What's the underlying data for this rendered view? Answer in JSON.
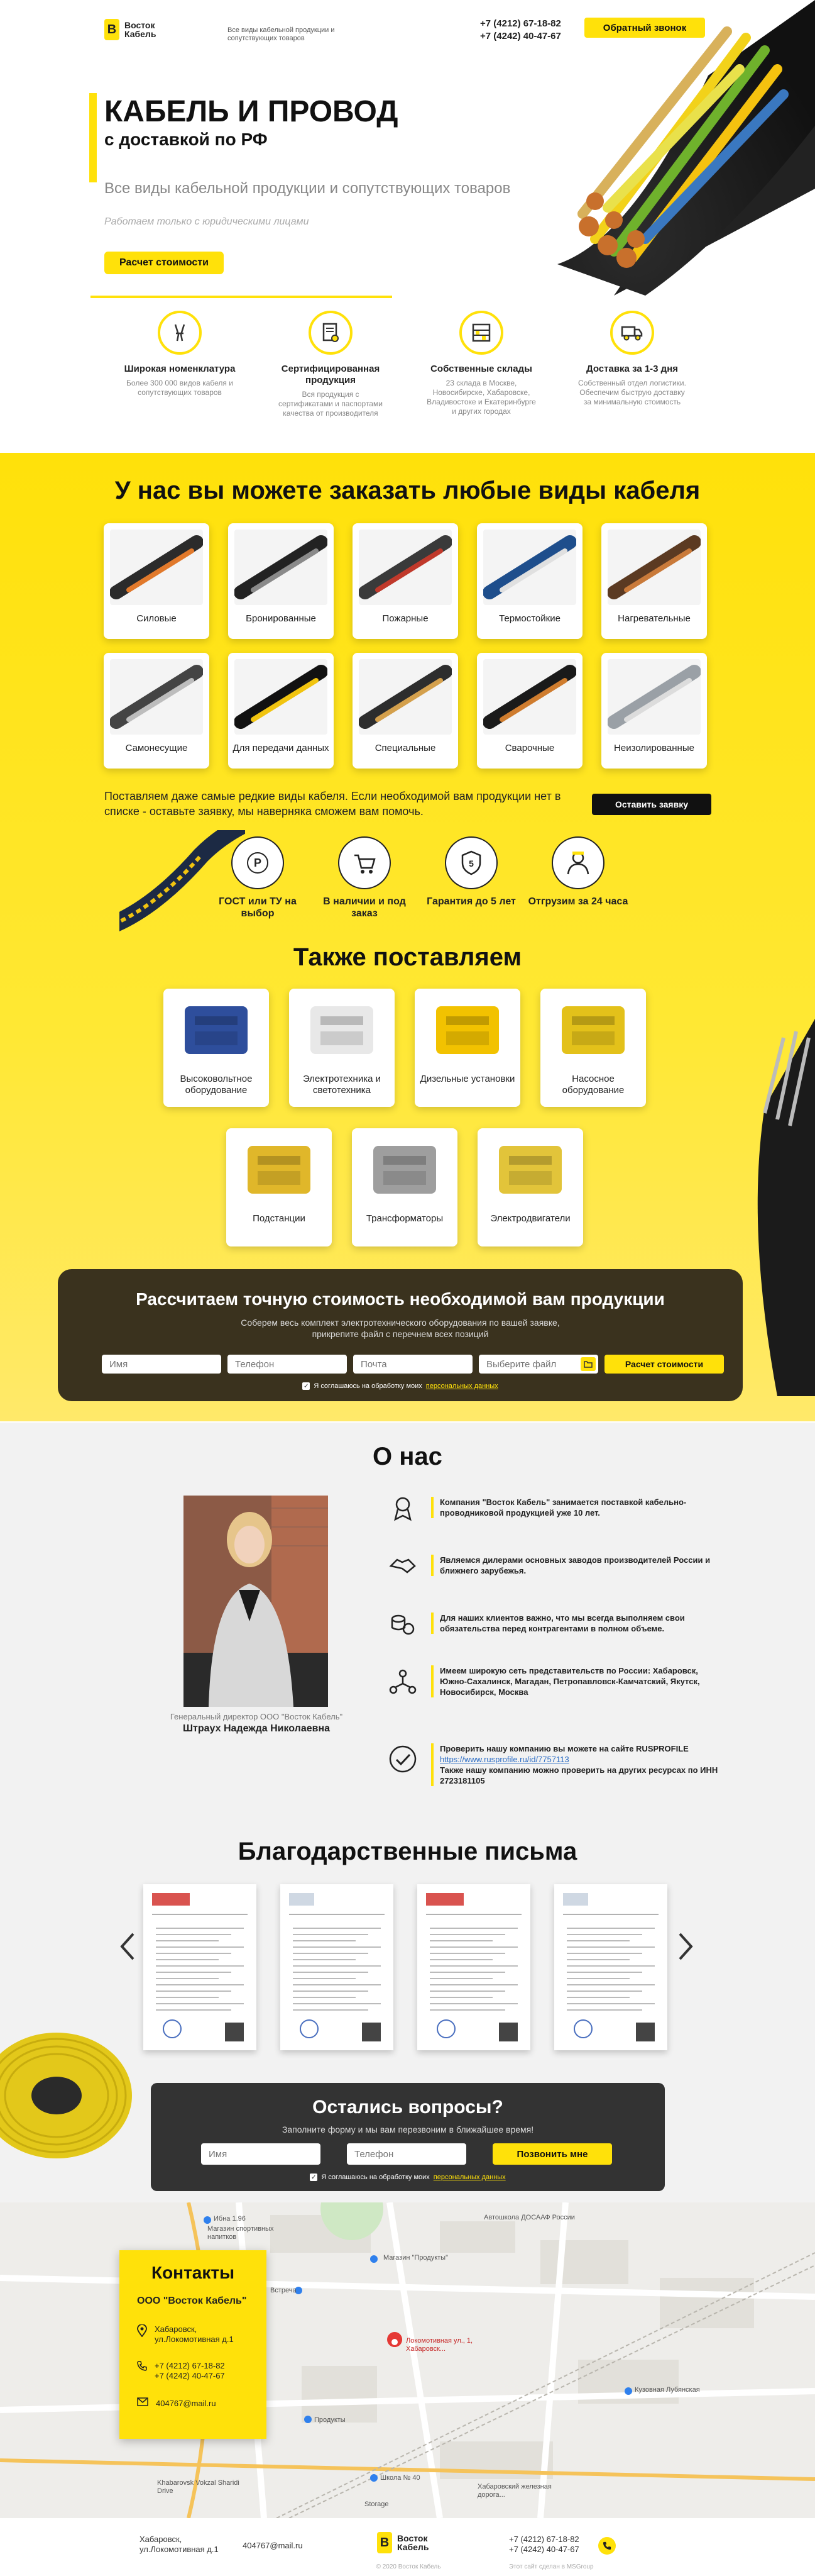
{
  "header": {
    "logo_line1": "Восток",
    "logo_line2": "Кабель",
    "tagline": "Все виды кабельной продукции и сопутствующих товаров",
    "phone1": "+7 (4212) 67-18-82",
    "phone2": "+7 (4242) 40-47-67",
    "callback": "Обратный звонок"
  },
  "hero": {
    "title": "КАБЕЛЬ И ПРОВОД",
    "subtitle": "с доставкой по РФ",
    "lead": "Все виды кабельной продукции и сопутствующих товаров",
    "note": "Работаем только с юридическими лицами",
    "cta": "Расчет стоимости"
  },
  "features": [
    {
      "title": "Широкая номенклатура",
      "text": "Более 300 000 видов кабеля и сопутствующих товаров",
      "icon": "pliers-icon"
    },
    {
      "title": "Сертифицированная продукция",
      "text": "Вся продукция с сертификатами и паспортами качества от производителя",
      "icon": "certificate-icon"
    },
    {
      "title": "Собственные склады",
      "text": "23 склада в Москве, Новосибирске, Хабаровске, Владивостоке и Екатеринбурге и других городах",
      "icon": "warehouse-icon"
    },
    {
      "title": "Доставка за 1-3 дня",
      "text": "Собственный отдел логистики. Обеспечим быструю доставку за минимальную стоимость",
      "icon": "truck-icon"
    }
  ],
  "catalog": {
    "heading": "У нас вы можете заказать любые виды кабеля",
    "items": [
      "Силовые",
      "Бронированные",
      "Пожарные",
      "Термостойкие",
      "Нагревательные",
      "Самонесущие",
      "Для передачи данных",
      "Специальные",
      "Сварочные",
      "Неизолированные"
    ],
    "rare_text": "Поставляем даже самые редкие виды кабеля. Если необходимой вам продукции нет в списке - оставьте заявку, мы наверняка сможем вам помочь.",
    "request_btn": "Оставить заявку"
  },
  "badges": [
    {
      "text": "ГОСТ или ТУ на выбор",
      "icon": "gost-icon"
    },
    {
      "text": "В наличии и под заказ",
      "icon": "cart-icon"
    },
    {
      "text": "Гарантия до 5 лет",
      "icon": "guarantee-icon"
    },
    {
      "text": "Отгрузим за 24 часа",
      "icon": "worker-icon"
    }
  ],
  "also": {
    "heading": "Также поставляем",
    "items": [
      "Высоковольтное оборудование",
      "Электротехника и светотехника",
      "Дизельные установки",
      "Насосное оборудование",
      "Подстанции",
      "Трансформаторы",
      "Электродвигатели"
    ]
  },
  "calc": {
    "heading": "Рассчитаем точную стоимость необходимой вам продукции",
    "text": "Соберем весь комплект электротехнического оборудования по вашей заявке, прикрепите файл с перечнем всех позиций",
    "name": "Имя",
    "phone": "Телефон",
    "email": "Почта",
    "file": "Выберите файл",
    "submit": "Расчет стоимости",
    "consent": "Я соглашаюсь на обработку моих",
    "consent_link": "персональных данных"
  },
  "about": {
    "heading": "О нас",
    "caption": "Генеральный директор ООО \"Восток Кабель\"",
    "director": "Штраух Надежда Николаевна",
    "facts": [
      {
        "text": "Компания \"Восток Кабель\" занимается поставкой кабельно-проводниковой продукцией уже 10 лет.",
        "icon": "medal-icon"
      },
      {
        "text": "Являемся дилерами основных заводов производителей России и ближнего зарубежья.",
        "icon": "handshake-icon"
      },
      {
        "text": "Для наших клиентов важно, что мы всегда выполняем свои обязательства перед контрагентами в полном объеме.",
        "icon": "coins-icon"
      },
      {
        "text": "Имеем широкую сеть представительств по России: Хабаровск, Южно-Сахалинск, Магадан, Петропавловск-Камчатский, Якутск, Новосибирск, Москва",
        "icon": "network-icon"
      }
    ],
    "check_text": "Проверить нашу компанию вы можете на сайте RUSPROFILE",
    "check_link": "https://www.rusprofile.ru/id/7757113",
    "check_more": "Также нашу компанию можно проверить на других ресурсах по ИНН 2723181105"
  },
  "letters": {
    "heading": "Благодарственные письма"
  },
  "questions": {
    "heading": "Остались вопросы?",
    "text": "Заполните форму и мы вам перезвоним в ближайшее время!",
    "name": "Имя",
    "phone": "Телефон",
    "submit": "Позвонить мне",
    "consent": "Я соглашаюсь на обработку моих",
    "consent_link": "персональных данных"
  },
  "contacts": {
    "heading": "Контакты",
    "company": "ООО \"Восток Кабель\"",
    "address": "Хабаровск, ул.Локомотивная д.1",
    "phone1": "+7 (4212) 67-18-82",
    "phone2": "+7 (4242) 40-47-67",
    "email": "404767@mail.ru"
  },
  "map": {
    "labels": [
      "Ибна 1.96",
      "Магазин спортивных напитков",
      "Автошкола ДОСААФ России",
      "Магазин \"Продукты\"",
      "Встреча",
      "Локомотивная ул., 1, Хабаровск...",
      "Продукты",
      "Кузовная Лубянская",
      "Школа № 40",
      "Khabarovsk Vokzal Sharidi Drive",
      "Хабаровский железная дорога...",
      "Storage"
    ]
  },
  "footer": {
    "address": "Хабаровск, ул.Локомотивная д.1",
    "email": "404767@mail.ru",
    "logo_line1": "Восток",
    "logo_line2": "Кабель",
    "copy": "© 2020 Восток Кабель",
    "phone1": "+7 (4212) 67-18-82",
    "phone2": "+7 (4242) 40-47-67",
    "made": "Этот сайт сделан в MSGroup"
  }
}
